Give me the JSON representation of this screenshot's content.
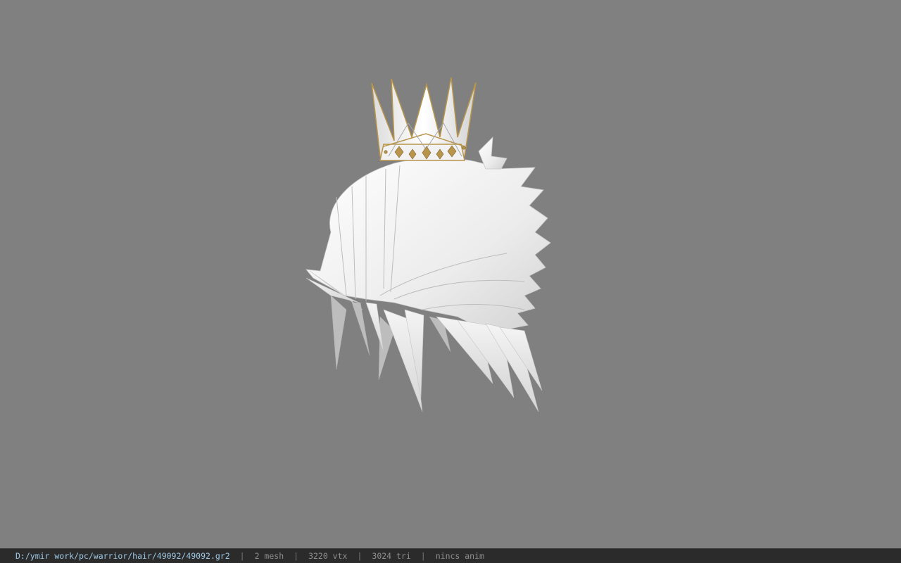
{
  "viewport": {
    "background_color": "#808080",
    "model": {
      "description_icon": "hair-with-crown-model",
      "hair_color": "#f2f2f2",
      "crown_color": "#e9e9e9",
      "crown_trim_color": "#b8954a"
    }
  },
  "statusbar": {
    "file_path": "D:/ymir work/pc/warrior/hair/49092/49092.gr2",
    "separator": "|",
    "mesh_count": "2 mesh",
    "vertex_count": "3220 vtx",
    "triangle_count": "3024 tri",
    "anim_status": "nincs anim",
    "path_color": "#9ec9e6",
    "background_color": "#2b2b2b"
  }
}
